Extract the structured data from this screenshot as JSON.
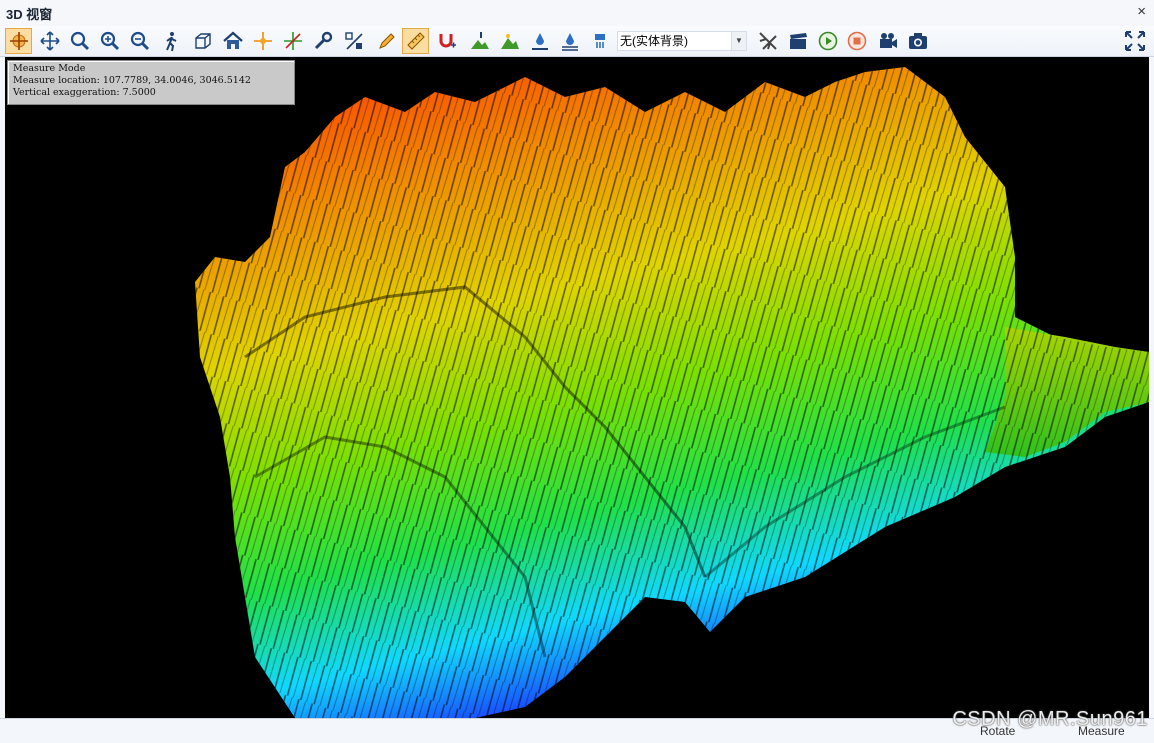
{
  "window": {
    "title": "3D 视窗",
    "close_glyph": "×"
  },
  "toolbar": {
    "background_select": {
      "value": "无(实体背景)"
    },
    "icons": [
      "measure-pan-icon",
      "pan-icon",
      "zoom-icon",
      "zoom-in-icon",
      "zoom-out-icon",
      "walk-icon",
      "box-icon",
      "home-icon",
      "target-icon",
      "crosshair-icon",
      "wrench-icon",
      "percent-icon",
      "pencil-icon",
      "ruler-icon",
      "magnet-icon",
      "terrain-point-icon",
      "terrain-add-icon",
      "drop-icon",
      "drop-down-icon",
      "water-icon",
      "plane-icon",
      "clapper-icon",
      "play-icon",
      "stop-icon",
      "camera-video-icon",
      "camera-icon",
      "fullscreen-icon"
    ]
  },
  "info_panel": {
    "line1": "Measure Mode",
    "line2": "Measure location: 107.7789, 34.0046, 3046.5142",
    "line3": "Vertical exaggeration: 7.5000"
  },
  "status": {
    "rotate": "Rotate",
    "measure": "Measure"
  },
  "watermark": "CSDN @MR.Sun961",
  "colors": {
    "terrain": [
      "#1a3cff",
      "#10d8ff",
      "#20e04a",
      "#7ee000",
      "#e0d400",
      "#f08a00",
      "#ff3000"
    ],
    "active_button": "#fbdca1"
  }
}
